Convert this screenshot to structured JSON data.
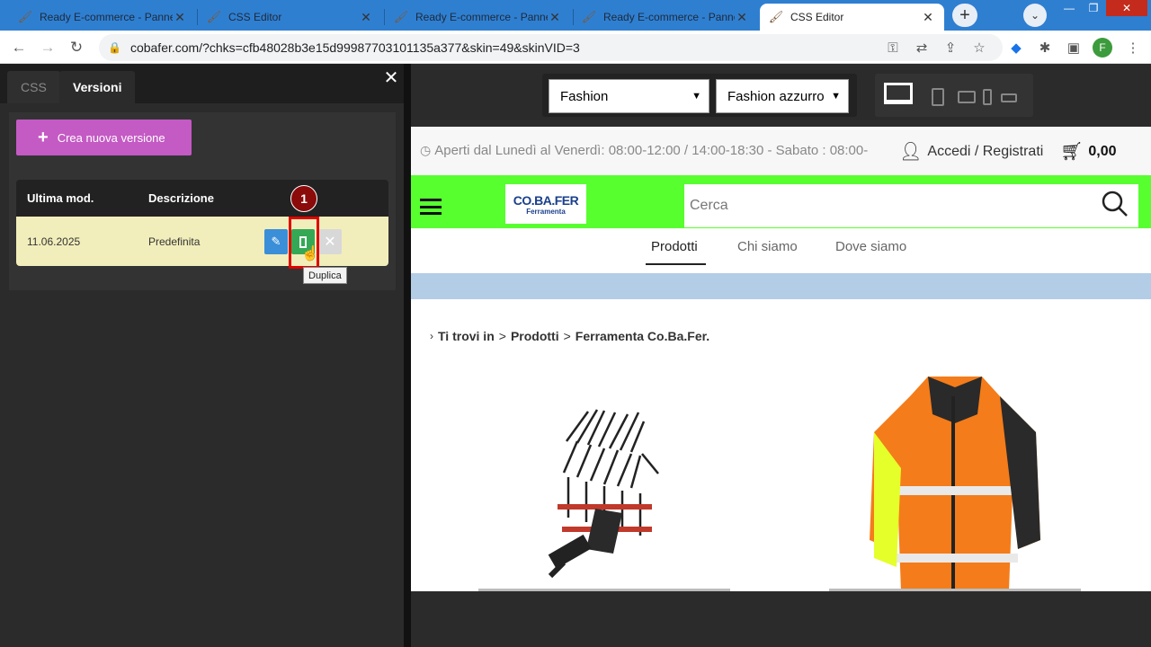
{
  "browser": {
    "tabs": [
      {
        "title": "Ready E-commerce - Panne",
        "active": false
      },
      {
        "title": "CSS Editor",
        "active": false
      },
      {
        "title": "Ready E-commerce - Panne",
        "active": false
      },
      {
        "title": "Ready E-commerce - Panne",
        "active": false
      },
      {
        "title": "CSS Editor",
        "active": true
      }
    ],
    "url": "cobafer.com/?chks=cfb48028b3e15d99987703101135a377&skin=49&skinVID=3",
    "profile_initial": "F"
  },
  "editor": {
    "tabs": [
      "CSS",
      "Versioni"
    ],
    "close_glyph": "✕",
    "new_version_label": "Crea nuova versione",
    "table": {
      "headers": [
        "Ultima mod.",
        "Descrizione"
      ],
      "rows": [
        {
          "date": "11.06.2025",
          "description": "Predefinita"
        }
      ]
    },
    "annotation_number": "1",
    "tooltip": "Duplica"
  },
  "preview": {
    "theme_select": "Fashion",
    "color_select": "Fashion azzurro",
    "site": {
      "opening_hours": "Aperti dal Lunedì al Venerdì: 08:00-12:00 / 14:00-18:30 - Sabato : 08:00-",
      "login_label": "Accedi / Registrati",
      "cart_total": "0,00",
      "logo_text": "CO.BA.FER",
      "logo_subtext": "Ferramenta",
      "search_placeholder": "Cerca",
      "nav": [
        "Prodotti",
        "Chi siamo",
        "Dove siamo"
      ],
      "breadcrumb": {
        "lead": "Ti trovi in",
        "items": [
          "Prodotti",
          "Ferramenta Co.Ba.Fer."
        ],
        "separator": ">"
      }
    }
  },
  "colors": {
    "site_header_green": "#57ff2f",
    "new_version_button": "#c45ac4",
    "highlight": "#e00000"
  }
}
